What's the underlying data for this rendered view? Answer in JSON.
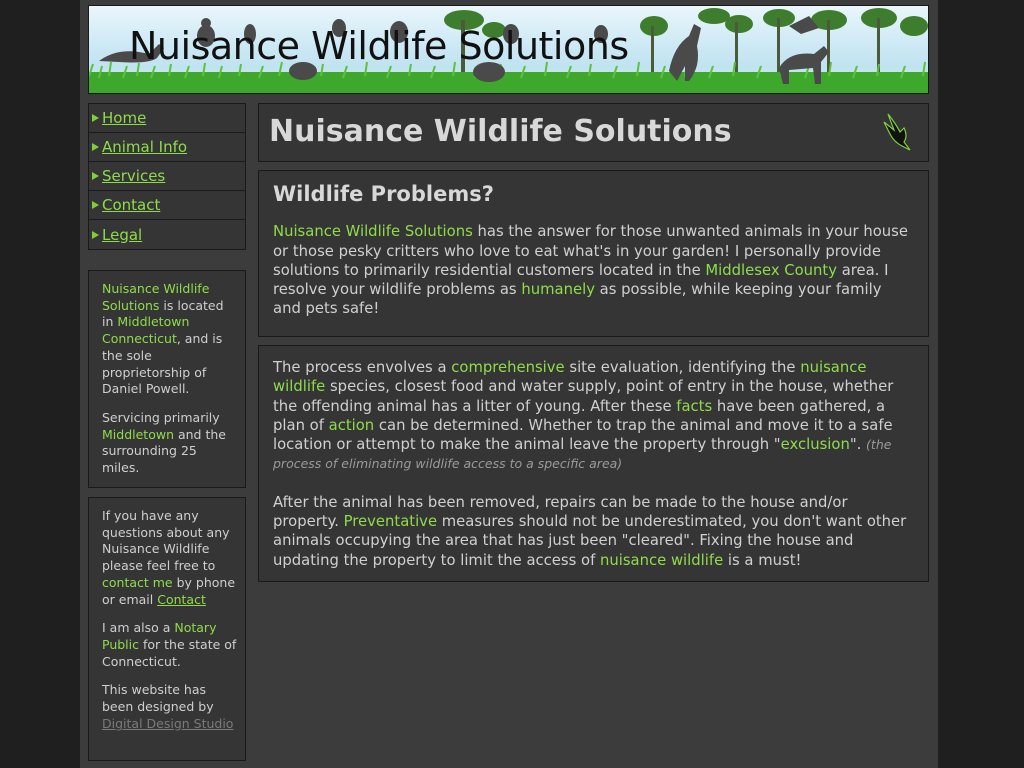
{
  "site": {
    "banner_title": "Nuisance Wildlife Solutions"
  },
  "nav": {
    "items": [
      {
        "label": "Home"
      },
      {
        "label": "Animal Info"
      },
      {
        "label": "Services"
      },
      {
        "label": "Contact"
      },
      {
        "label": "Legal"
      }
    ]
  },
  "sidebar": {
    "location": {
      "company": "Nuisance Wildlife Solutions",
      "t1": " is located in ",
      "place": "Middletown Connecticut",
      "t2": ", and is the sole proprietorship of Daniel Powell."
    },
    "servicing": {
      "t1": "Servicing primarily ",
      "place": "Middletown",
      "t2": " and the surrounding 25 miles."
    },
    "questions": {
      "t1": "If you have any questions about any Nuisance Wildlife please feel free to ",
      "contact_me": "contact me",
      "t2": " by phone or email ",
      "contact_link": "Contact"
    },
    "notary": {
      "t1": "I am also a ",
      "notary": "Notary Public",
      "t2": " for the state of Connecticut."
    },
    "designer": {
      "t1": "This website has been designed by ",
      "studio": "Digital Design Studio"
    }
  },
  "header": {
    "title": "Nuisance Wildlife Solutions"
  },
  "main": {
    "heading": "Wildlife Problems?",
    "intro": {
      "company": "Nuisance Wildlife Solutions",
      "t1": " has the answer for those unwanted animals in your house or those pesky critters who love to eat what's in your garden! I personally provide solutions to primarily residential customers located in the ",
      "county": "Middlesex County",
      "t2": " area. I resolve your wildlife problems as ",
      "humanely": "humanely",
      "t3": " as possible, while keeping your family and pets safe!"
    },
    "process": {
      "t1": "The process envolves a ",
      "comprehensive": "comprehensive",
      "t2": " site evaluation, identifying the ",
      "nuisance_wildlife": "nuisance wildlife",
      "t3": " species, closest food and water supply, point of entry in the house, whether the offending animal has a litter of young. After these ",
      "facts": "facts",
      "t4": " have been gathered, a plan of ",
      "action": "action",
      "t5": " can be determined. Whether to trap the animal and move it to a safe location or attempt to make the animal leave the property through \"",
      "exclusion": "exclusion",
      "t6": "\". ",
      "note": "(the process of eliminating wildlife access to a specific area)"
    },
    "after": {
      "t1": "After the animal has been removed, repairs can be made to the house and/or property. ",
      "preventative": "Preventative",
      "t2": " measures should not be underestimated, you don't want other animals occupying the area that has just been \"cleared\". Fixing the house and updating the property to limit the access of ",
      "nuisance_wildlife": "nuisance wildlife",
      "t3": " is a must!"
    }
  }
}
